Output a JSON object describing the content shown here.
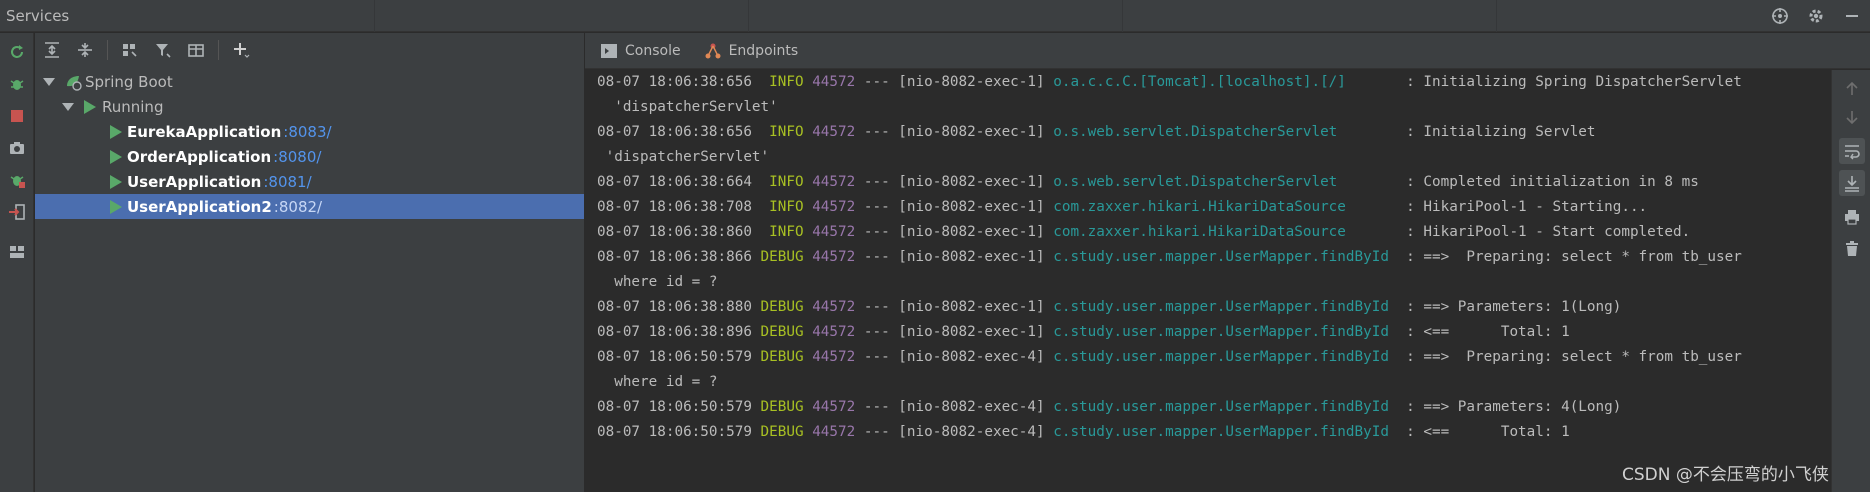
{
  "window": {
    "title": "Services"
  },
  "toolbar": {
    "buttons": [
      "expand-all-icon",
      "collapse-all-icon",
      "group-icon",
      "filter-icon",
      "new-tab-icon",
      "add-icon"
    ]
  },
  "tree": {
    "root": {
      "label": "Spring Boot"
    },
    "group": {
      "label": "Running"
    },
    "apps": [
      {
        "name": "EurekaApplication",
        "port": ":8083/"
      },
      {
        "name": "OrderApplication",
        "port": ":8080/"
      },
      {
        "name": "UserApplication",
        "port": ":8081/"
      },
      {
        "name": "UserApplication2",
        "port": ":8082/"
      }
    ]
  },
  "tabs": [
    {
      "label": "Console"
    },
    {
      "label": "Endpoints"
    }
  ],
  "console": {
    "lines": [
      {
        "ts": "08-07 18:06:38:656",
        "level": " INFO",
        "pid": "44572",
        "thread": " --- [nio-8082-exec-1] ",
        "logger": "o.a.c.c.C.[Tomcat].[localhost].[/]      ",
        "msg": " : Initializing Spring DispatcherServlet"
      },
      {
        "cont": "  'dispatcherServlet'"
      },
      {
        "ts": "08-07 18:06:38:656",
        "level": " INFO",
        "pid": "44572",
        "thread": " --- [nio-8082-exec-1] ",
        "logger": "o.s.web.servlet.DispatcherServlet       ",
        "msg": " : Initializing Servlet"
      },
      {
        "cont": " 'dispatcherServlet'"
      },
      {
        "ts": "08-07 18:06:38:664",
        "level": " INFO",
        "pid": "44572",
        "thread": " --- [nio-8082-exec-1] ",
        "logger": "o.s.web.servlet.DispatcherServlet       ",
        "msg": " : Completed initialization in 8 ms"
      },
      {
        "ts": "08-07 18:06:38:708",
        "level": " INFO",
        "pid": "44572",
        "thread": " --- [nio-8082-exec-1] ",
        "logger": "com.zaxxer.hikari.HikariDataSource      ",
        "msg": " : HikariPool-1 - Starting..."
      },
      {
        "ts": "08-07 18:06:38:860",
        "level": " INFO",
        "pid": "44572",
        "thread": " --- [nio-8082-exec-1] ",
        "logger": "com.zaxxer.hikari.HikariDataSource      ",
        "msg": " : HikariPool-1 - Start completed."
      },
      {
        "ts": "08-07 18:06:38:866",
        "level": "DEBUG",
        "pid": "44572",
        "thread": " --- [nio-8082-exec-1] ",
        "logger": "c.study.user.mapper.UserMapper.findById ",
        "msg": " : ==>  Preparing: select * from tb_user"
      },
      {
        "cont": "  where id = ?"
      },
      {
        "ts": "08-07 18:06:38:880",
        "level": "DEBUG",
        "pid": "44572",
        "thread": " --- [nio-8082-exec-1] ",
        "logger": "c.study.user.mapper.UserMapper.findById ",
        "msg": " : ==> Parameters: 1(Long)"
      },
      {
        "ts": "08-07 18:06:38:896",
        "level": "DEBUG",
        "pid": "44572",
        "thread": " --- [nio-8082-exec-1] ",
        "logger": "c.study.user.mapper.UserMapper.findById ",
        "msg": " : <==      Total: 1"
      },
      {
        "ts": "08-07 18:06:50:579",
        "level": "DEBUG",
        "pid": "44572",
        "thread": " --- [nio-8082-exec-4] ",
        "logger": "c.study.user.mapper.UserMapper.findById ",
        "msg": " : ==>  Preparing: select * from tb_user"
      },
      {
        "cont": "  where id = ?"
      },
      {
        "ts": "08-07 18:06:50:579",
        "level": "DEBUG",
        "pid": "44572",
        "thread": " --- [nio-8082-exec-4] ",
        "logger": "c.study.user.mapper.UserMapper.findById ",
        "msg": " : ==> Parameters: 4(Long)"
      },
      {
        "ts": "08-07 18:06:50:579",
        "level": "DEBUG",
        "pid": "44572",
        "thread": " --- [nio-8082-exec-4] ",
        "logger": "c.study.user.mapper.UserMapper.findById ",
        "msg": " : <==      Total: 1"
      }
    ]
  },
  "watermark": {
    "text": "CSDN @不会压弯的小飞侠"
  },
  "colors": {
    "panel": "#3c3f41",
    "console_bg": "#2b2b2b",
    "selection": "#4b6eaf",
    "log_level": "#a8c023",
    "pid": "#9876aa",
    "logger": "#299999",
    "run_green": "#59a869",
    "stop_red": "#c75450"
  }
}
